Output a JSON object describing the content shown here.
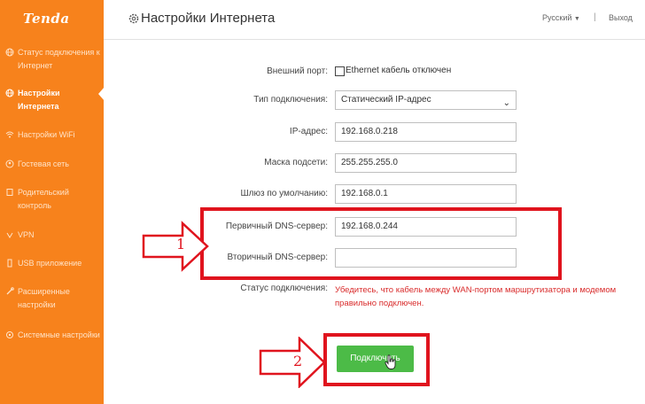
{
  "app": {
    "brand": "Tenda"
  },
  "sidebar": {
    "items": [
      {
        "label": "Статус подключения к Интернет",
        "icon": "globe-icon"
      },
      {
        "label": "Настройки Интернета",
        "icon": "globe-icon",
        "active": true
      },
      {
        "label": "Настройки WiFi",
        "icon": "wifi-icon"
      },
      {
        "label": "Гостевая сеть",
        "icon": "guest-icon"
      },
      {
        "label": "Родительский контроль",
        "icon": "parent-icon"
      },
      {
        "label": "VPN",
        "icon": "vpn-icon"
      },
      {
        "label": "USB приложение",
        "icon": "usb-icon"
      },
      {
        "label": "Расширенные настройки",
        "icon": "tools-icon"
      },
      {
        "label": "Системные настройки",
        "icon": "system-icon"
      }
    ]
  },
  "header": {
    "title": "Настройки Интернета",
    "language": "Русский",
    "separator": "|",
    "logout": "Выход"
  },
  "form": {
    "wan_port_label": "Внешний порт:",
    "wan_port_status": "Ethernet кабель отключен",
    "conn_type_label": "Тип подключения:",
    "conn_type_value": "Статический IP-адрес",
    "ip_label": "IP-адрес:",
    "ip_value": "192.168.0.218",
    "mask_label": "Маска подсети:",
    "mask_value": "255.255.255.0",
    "gateway_label": "Шлюз по умолчанию:",
    "gateway_value": "192.168.0.1",
    "dns1_label": "Первичный DNS-сервер:",
    "dns1_value": "192.168.0.244",
    "dns2_label": "Вторичный DNS-сервер:",
    "dns2_value": "",
    "status_label": "Статус подключения:",
    "status_text": "Убедитесь, что кабель между WAN-портом маршрутизатора и модемом правильно подключен.",
    "connect_button": "Подключить"
  },
  "annotations": {
    "marker1": "1",
    "marker2": "2",
    "color": "#e0141e"
  },
  "colors": {
    "sidebar": "#f7821c",
    "button": "#4cbb47",
    "error": "#d92c2c"
  }
}
